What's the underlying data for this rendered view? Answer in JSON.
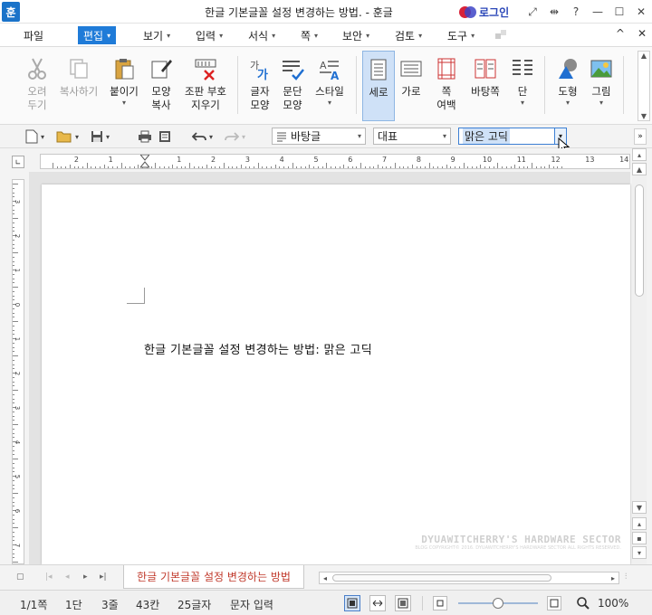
{
  "window": {
    "title": "한글 기본글꼴 설정 변경하는 방법. - 훈글",
    "app_icon": "훈",
    "login": "로그인",
    "controls": [
      "⤢",
      "⇹",
      "?",
      "—",
      "☐",
      "✕"
    ]
  },
  "menu": {
    "items": [
      {
        "label": "파일",
        "caret": false
      },
      {
        "label": "편집",
        "caret": true,
        "active": true
      },
      {
        "label": "보기",
        "caret": true
      },
      {
        "label": "입력",
        "caret": true
      },
      {
        "label": "서식",
        "caret": true
      },
      {
        "label": "쪽",
        "caret": true
      },
      {
        "label": "보안",
        "caret": true
      },
      {
        "label": "검토",
        "caret": true
      },
      {
        "label": "도구",
        "caret": true
      }
    ],
    "right": [
      "^",
      "✕"
    ]
  },
  "ribbon": {
    "cut": "오려\n두기",
    "copy": "복사하기",
    "paste": "붙이기",
    "format_copy": "모양\n복사",
    "clear_marks": "조판 부호\n지우기",
    "char_shape": "글자\n모양",
    "para_shape": "문단\n모양",
    "style": "스타일",
    "vertical": "세로",
    "horizontal": "가로",
    "page_margin": "쪽\n여백",
    "page_bg": "바탕쪽",
    "columns": "단",
    "shapes": "도형",
    "picture": "그림",
    "dropdown_caret": "▾"
  },
  "toolbar": {
    "style_value": "바탕글",
    "lang_value": "대표",
    "font_value": "맑은 고딕"
  },
  "ruler": {
    "h_numbers": [
      "2",
      "1",
      "1",
      "2",
      "3",
      "4",
      "5",
      "6",
      "7",
      "8",
      "9",
      "10",
      "11",
      "12",
      "13",
      "14"
    ],
    "v_numbers": [
      "3",
      "2",
      "1",
      "0",
      "1",
      "2",
      "3",
      "4",
      "5",
      "6",
      "7"
    ]
  },
  "document": {
    "text": "한글 기본글꼴 설정 변경하는 방법: 맑은 고딕",
    "watermark_title": "DYUAWITCHERRY'S HARDWARE SECTOR",
    "watermark_sub": "BLOG COPYRIGHT© 2016. DYUAWITCHERRY'S HARDWARE SECTOR ALL RIGHTS RESERVED."
  },
  "tabs": {
    "active": "한글 기본글꼴 설정 변경하는 방법"
  },
  "status": {
    "page": "1/1쪽",
    "column": "1단",
    "line": "3줄",
    "col_pos": "43칸",
    "chars": "25글자",
    "mode": "문자 입력",
    "zoom": "100%"
  },
  "colors": {
    "accent": "#1f7bd8",
    "tab_text": "#c0392b"
  }
}
